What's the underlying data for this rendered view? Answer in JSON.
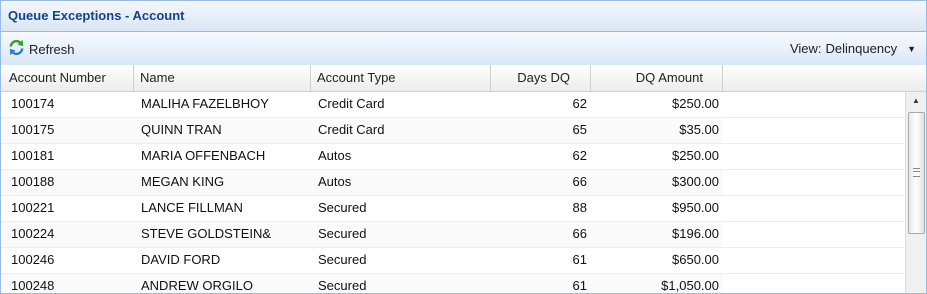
{
  "panel": {
    "title": "Queue Exceptions - Account"
  },
  "toolbar": {
    "refresh_label": "Refresh",
    "view_label": "View:",
    "view_value": "Delinquency"
  },
  "grid": {
    "columns": [
      "Account Number",
      "Name",
      "Account Type",
      "Days DQ",
      "DQ Amount"
    ],
    "rows": [
      [
        "100174",
        "MALIHA FAZELBHOY",
        "Credit Card",
        "62",
        "$250.00"
      ],
      [
        "100175",
        "QUINN TRAN",
        "Credit Card",
        "65",
        "$35.00"
      ],
      [
        "100181",
        "MARIA OFFENBACH",
        "Autos",
        "62",
        "$250.00"
      ],
      [
        "100188",
        "MEGAN KING",
        "Autos",
        "66",
        "$300.00"
      ],
      [
        "100221",
        "LANCE FILLMAN",
        "Secured",
        "88",
        "$950.00"
      ],
      [
        "100224",
        "STEVE GOLDSTEIN&",
        "Secured",
        "66",
        "$196.00"
      ],
      [
        "100246",
        "DAVID FORD",
        "Secured",
        "61",
        "$650.00"
      ],
      [
        "100248",
        "ANDREW ORGILO",
        "Secured",
        "61",
        "$1,050.00"
      ]
    ]
  },
  "icons": {
    "refresh": "refresh-icon",
    "dropdown": "chevron-down-icon",
    "scroll_up": "arrow-up-icon"
  },
  "colors": {
    "title_text": "#15428b",
    "border": "#99bbe8"
  }
}
